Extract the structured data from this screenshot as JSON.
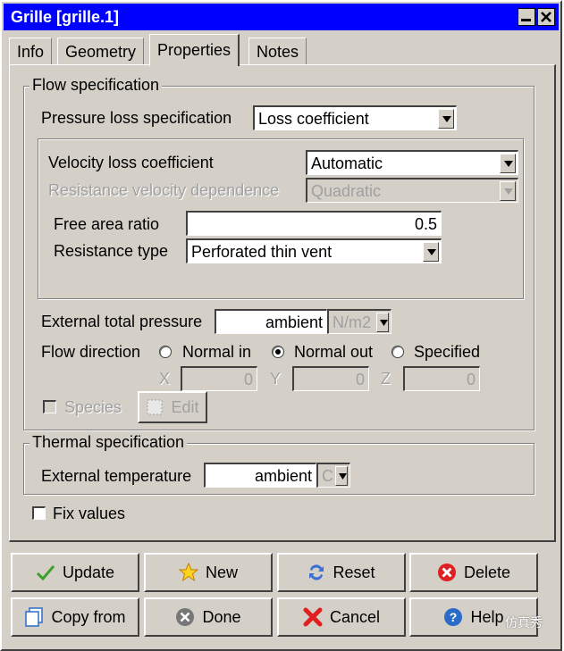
{
  "window": {
    "title": "Grille [grille.1]"
  },
  "tabs": [
    {
      "label": "Info"
    },
    {
      "label": "Geometry"
    },
    {
      "label": "Properties"
    },
    {
      "label": "Notes"
    }
  ],
  "flow": {
    "legend": "Flow specification",
    "pressure_loss_label": "Pressure loss specification",
    "pressure_loss_value": "Loss coefficient",
    "velocity_loss_label": "Velocity loss coefficient",
    "velocity_loss_value": "Automatic",
    "resistance_velocity_label": "Resistance velocity dependence",
    "resistance_velocity_value": "Quadratic",
    "free_area_label": "Free area ratio",
    "free_area_value": "0.5",
    "resistance_type_label": "Resistance type",
    "resistance_type_value": "Perforated thin vent",
    "external_pressure_label": "External total pressure",
    "external_pressure_value": "ambient",
    "external_pressure_unit": "N/m2",
    "flow_direction_label": "Flow direction",
    "direction_options": [
      "Normal in",
      "Normal out",
      "Specified"
    ],
    "direction_selected": "Normal out",
    "x_label": "X",
    "x_value": "0",
    "y_label": "Y",
    "y_value": "0",
    "z_label": "Z",
    "z_value": "0",
    "species_label": "Species",
    "edit_label": "Edit"
  },
  "thermal": {
    "legend": "Thermal specification",
    "external_temp_label": "External temperature",
    "external_temp_value": "ambient",
    "external_temp_unit": "C"
  },
  "fix_values_label": "Fix values",
  "buttons": {
    "update": "Update",
    "new": "New",
    "reset": "Reset",
    "delete": "Delete",
    "copy_from": "Copy from",
    "done": "Done",
    "cancel": "Cancel",
    "help": "Help"
  },
  "watermark": "仿真秀",
  "colors": {
    "title_bar": "#0000ff",
    "face": "#d4d0c8"
  }
}
